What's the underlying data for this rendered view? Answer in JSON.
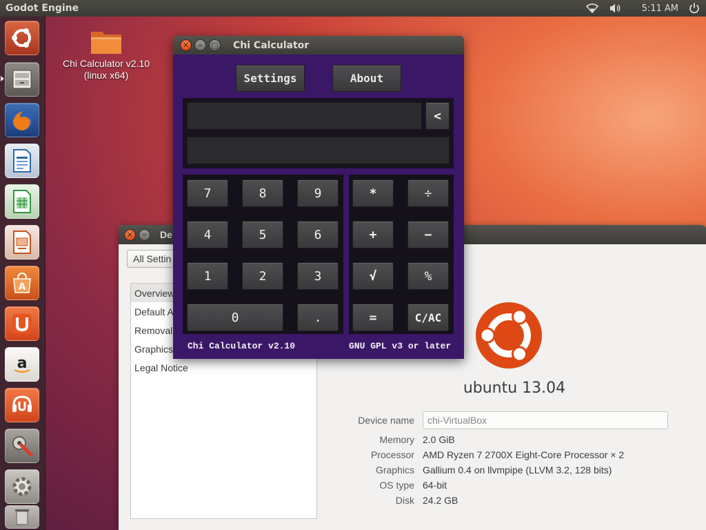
{
  "top_panel": {
    "app_title": "Godot Engine",
    "clock": "5:11 AM",
    "wifi_icon": "wifi-icon",
    "volume_icon": "volume-icon",
    "power_icon": "power-icon"
  },
  "launcher": {
    "items": [
      {
        "name": "dash-home",
        "icon": "ubuntu-dash-icon",
        "color": "#c34a2e"
      },
      {
        "name": "files",
        "icon": "files-icon",
        "color": "#6e6a64"
      },
      {
        "name": "firefox",
        "icon": "firefox-icon",
        "color": "#e36a1c"
      },
      {
        "name": "libreoffice-writer",
        "icon": "writer-icon",
        "color": "#3f82c4"
      },
      {
        "name": "libreoffice-calc",
        "icon": "calc-icon",
        "color": "#3fa44b"
      },
      {
        "name": "libreoffice-impress",
        "icon": "impress-icon",
        "color": "#c7582b"
      },
      {
        "name": "software-center",
        "icon": "software-center-icon",
        "color": "#e0621f"
      },
      {
        "name": "ubuntu-one",
        "icon": "ubuntu-one-icon",
        "color": "#e95420"
      },
      {
        "name": "amazon",
        "icon": "amazon-icon",
        "color": "#f0ede8"
      },
      {
        "name": "ubuntu-one-music",
        "icon": "ubuntu-one-music-icon",
        "color": "#e95420"
      },
      {
        "name": "system-settings",
        "icon": "settings-icon",
        "color": "#8a8782"
      },
      {
        "name": "godot",
        "icon": "gear-icon",
        "color": "#9a9892"
      }
    ]
  },
  "desktop": {
    "folder_label_line1": "Chi Calculator v2.10",
    "folder_label_line2": "(linux x64)"
  },
  "details": {
    "title": "De",
    "all_settings": "All Settin",
    "sidebar": [
      "Overview",
      "Default A",
      "Removal",
      "Graphics",
      "Legal Notice"
    ],
    "distro": "ubuntu 13.04",
    "device_name_label": "Device name",
    "device_name_value": "chi-VirtualBox",
    "rows": [
      {
        "key": "Memory",
        "value": "2.0 GiB"
      },
      {
        "key": "Processor",
        "value": "AMD Ryzen 7 2700X Eight-Core Processor × 2"
      },
      {
        "key": "Graphics",
        "value": "Gallium 0.4 on llvmpipe (LLVM 3.2, 128 bits)"
      },
      {
        "key": "OS type",
        "value": "64-bit"
      },
      {
        "key": "Disk",
        "value": "24.2 GB"
      }
    ]
  },
  "calculator": {
    "title": "Chi Calculator",
    "settings_label": "Settings",
    "about_label": "About",
    "backspace_label": "<",
    "expression": "",
    "result": "",
    "digits": {
      "k7": "7",
      "k8": "8",
      "k9": "9",
      "k4": "4",
      "k5": "5",
      "k6": "6",
      "k1": "1",
      "k2": "2",
      "k3": "3",
      "k0": "0",
      "dot": "."
    },
    "ops": {
      "mul": "*",
      "div": "÷",
      "add": "+",
      "sub": "−",
      "sqrt": "√",
      "pct": "%",
      "eq": "=",
      "clear": "C/AC"
    },
    "footer_left": "Chi Calculator v2.10",
    "footer_right": "GNU GPL v3 or later",
    "colors": {
      "background": "#3b1768",
      "panel": "#15111b",
      "button": "#444345"
    }
  }
}
